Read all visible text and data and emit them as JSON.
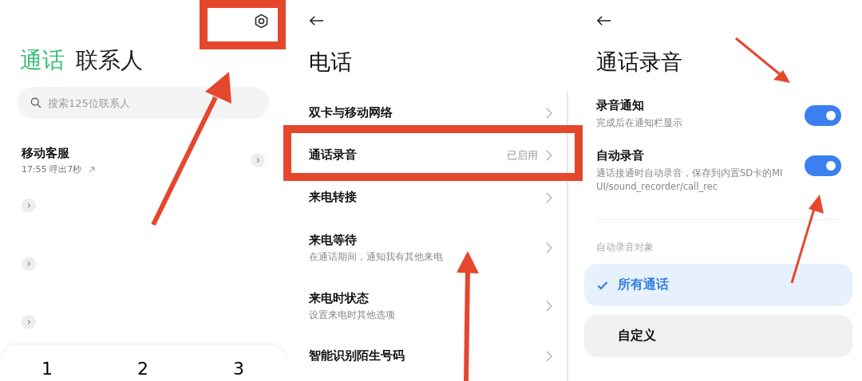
{
  "dialer": {
    "tabs": [
      {
        "label": "通话",
        "selected": true
      },
      {
        "label": "联系人",
        "selected": false
      }
    ],
    "search": {
      "placeholder": "搜索125位联系人"
    },
    "calls": [
      {
        "name": "移动客服",
        "detail": "17:55 呼出7秒"
      }
    ],
    "keypad": [
      "1",
      "2",
      "3"
    ]
  },
  "phone_settings": {
    "title": "电话",
    "items": [
      {
        "label": "双卡与移动网络"
      },
      {
        "label": "通话录音",
        "value": "已启用"
      },
      {
        "label": "来电转接"
      },
      {
        "label": "来电等待",
        "subtitle": "在通话期间，通知我有其他来电"
      },
      {
        "label": "来电时状态",
        "subtitle": "设置来电时其他选项"
      },
      {
        "label": "智能识别陌生号码"
      }
    ]
  },
  "call_recording": {
    "title": "通话录音",
    "toggles": [
      {
        "label": "录音通知",
        "subtitle": "完成后在通知栏显示",
        "on": true
      },
      {
        "label": "自动录音",
        "subtitle": "通话接通时自动录音，保存到内置SD卡的MIUI/sound_recorder/call_rec",
        "on": true
      }
    ],
    "section_label": "自动录音对象",
    "options": [
      {
        "label": "所有通话",
        "selected": true
      },
      {
        "label": "自定义",
        "selected": false
      }
    ]
  }
}
